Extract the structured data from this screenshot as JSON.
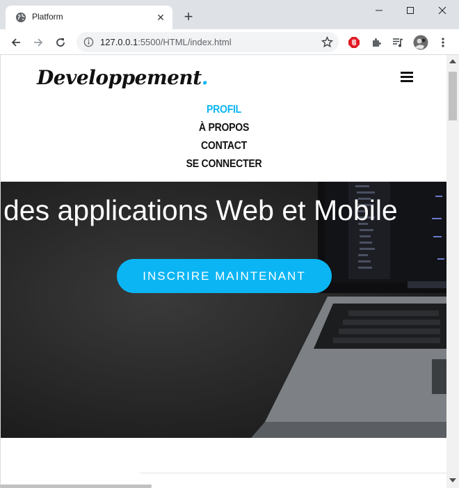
{
  "browser": {
    "tab_title": "Platform",
    "url_host": "127.0.0.1",
    "url_rest": ":5500/HTML/index.html"
  },
  "site": {
    "brand": "Developpement",
    "brand_dot": ".",
    "menu": [
      {
        "label": "PROFIL"
      },
      {
        "label": "À PROPOS"
      },
      {
        "label": "CONTACT"
      },
      {
        "label": "SE CONNECTER"
      }
    ],
    "hero": {
      "title": "des applications Web et Mobile",
      "cta": "INSCRIRE MAINTENANT"
    }
  },
  "colors": {
    "accent": "#0bb5f4",
    "tabstrip": "#dee1e6"
  }
}
